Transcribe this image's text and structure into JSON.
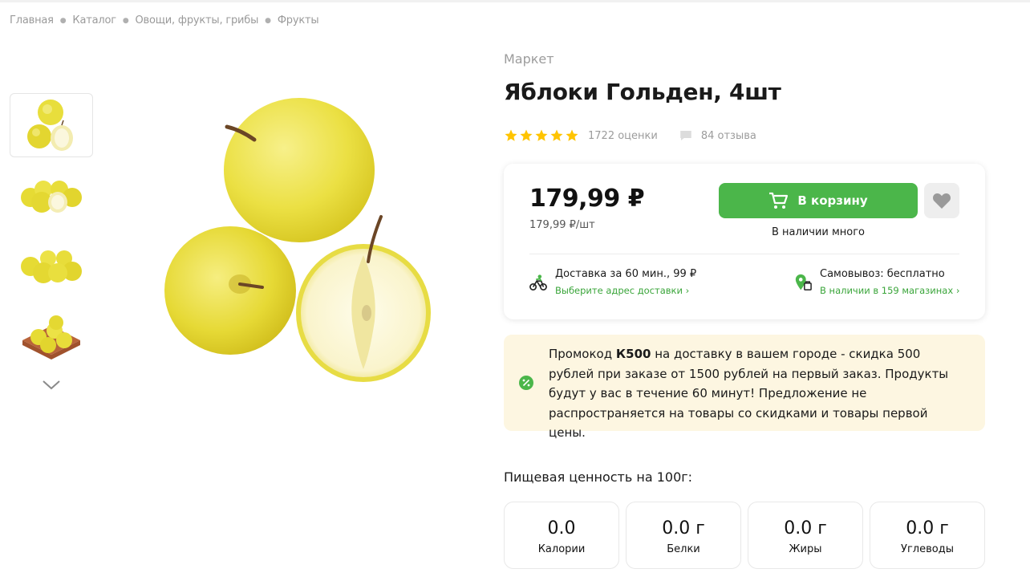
{
  "breadcrumbs": [
    "Главная",
    "Каталог",
    "Овощи, фрукты, грибы",
    "Фрукты"
  ],
  "thumbnails": [
    "apples-thumbnail-1",
    "apples-thumbnail-2",
    "apples-thumbnail-3",
    "apples-thumbnail-4"
  ],
  "product": {
    "seller": "Маркет",
    "title": "Яблоки Гольден, 4шт",
    "rating": 5,
    "ratings_count": "1722 оценки",
    "reviews_count": "84 отзыва"
  },
  "buy": {
    "price": "179,99 ₽",
    "unit_price": "179,99 ₽/шт",
    "cart_button": "В корзину",
    "stock": "В наличии много",
    "delivery_title": "Доставка за 60 мин., 99 ₽",
    "delivery_link": "Выберите адрес доставки",
    "pickup_title": "Самовывоз: бесплатно",
    "pickup_link": "В наличии в 159 магазинах",
    "link_chevron": "›"
  },
  "promo": {
    "prefix": "Промокод",
    "code": "К500",
    "text": "на доставку в вашем городе - скидка 500 рублей при заказе от 1500 рублей на первый заказ. Продукты будут у вас в течение 60 минут! Предложение не распространяется на товары со скидками и товары первой цены."
  },
  "nutrition": {
    "title": "Пищевая ценность на 100г:",
    "items": [
      {
        "value": "0.0",
        "label": "Калории"
      },
      {
        "value": "0.0 г",
        "label": "Белки"
      },
      {
        "value": "0.0 г",
        "label": "Жиры"
      },
      {
        "value": "0.0 г",
        "label": "Углеводы"
      }
    ]
  },
  "colors": {
    "accent_green": "#4bb64a",
    "link_green": "#3aa53a",
    "star_yellow": "#ffc400",
    "promo_bg": "#fdf6e1"
  }
}
